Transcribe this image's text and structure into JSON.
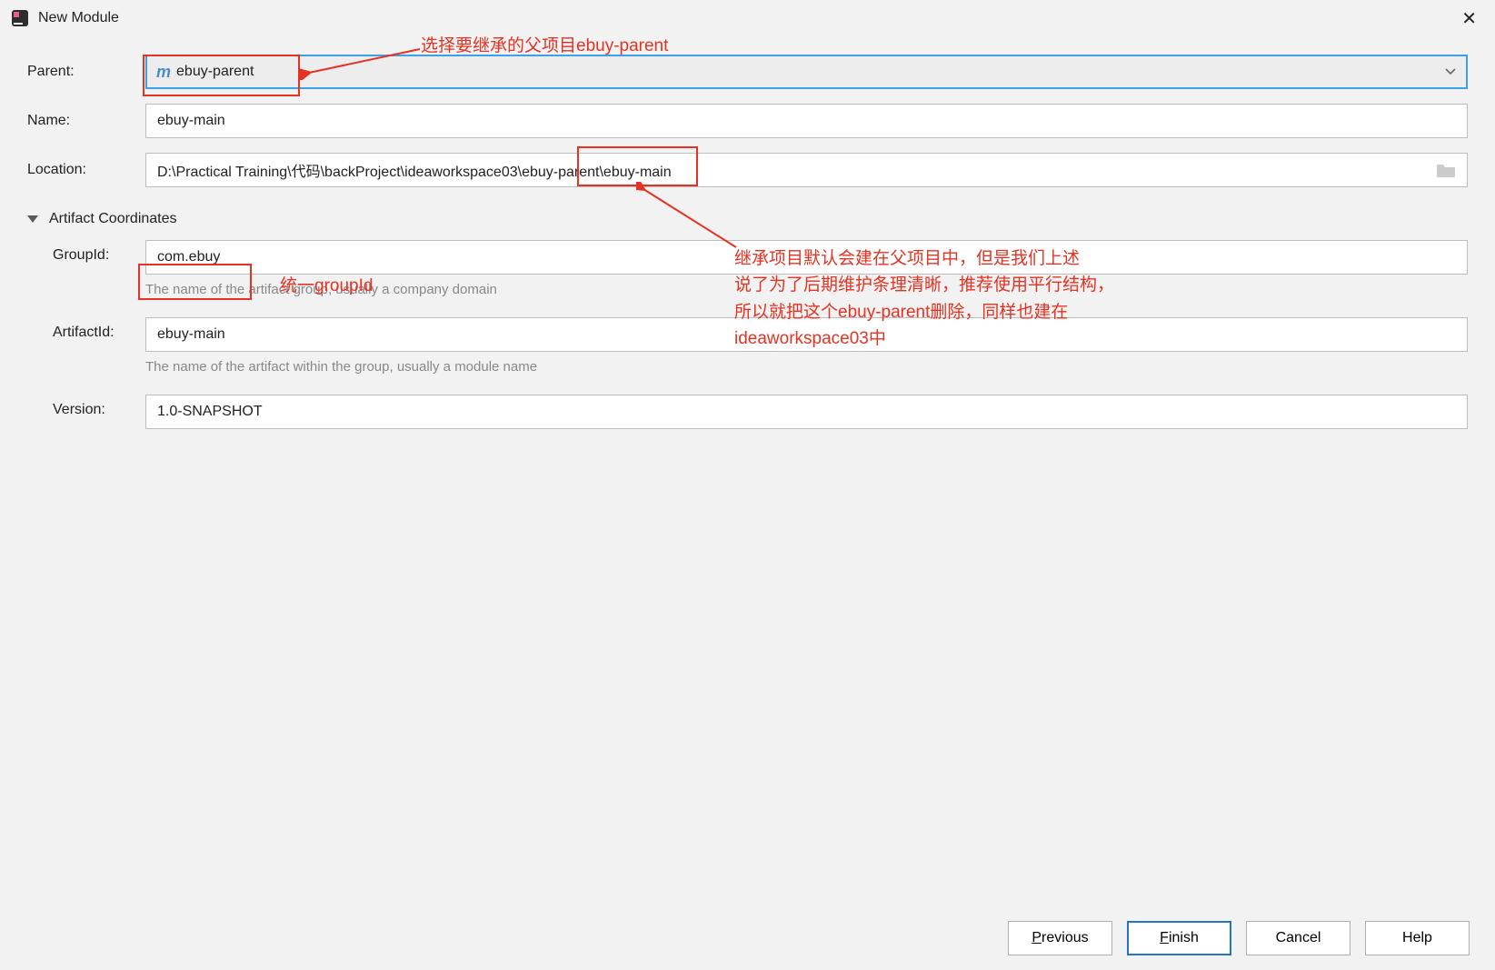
{
  "titlebar": {
    "title": "New Module"
  },
  "fields": {
    "parent_label": "Parent:",
    "parent_value": "ebuy-parent",
    "name_label": "Name:",
    "name_value": "ebuy-main",
    "location_label": "Location:",
    "location_prefix": "D:\\Practical Training\\代码\\backProject\\ideaworkspace03",
    "location_mid": "\\ebuy-parent",
    "location_suffix": "\\ebuy-main"
  },
  "section": {
    "title": "Artifact Coordinates"
  },
  "artifact": {
    "groupid_label": "GroupId:",
    "groupid_value": "com.ebuy",
    "groupid_hint": "The name of the artifact group, usually a company domain",
    "artifactid_label": "ArtifactId:",
    "artifactid_value": "ebuy-main",
    "artifactid_hint": "The name of the artifact within the group, usually a module name",
    "version_label": "Version:",
    "version_value": "1.0-SNAPSHOT"
  },
  "buttons": {
    "previous_p": "P",
    "previous_rest": "revious",
    "finish_f": "F",
    "finish_rest": "inish",
    "cancel": "Cancel",
    "help": "Help"
  },
  "annotations": {
    "annot1": "选择要继承的父项目ebuy-parent",
    "annot2": "统一groupId",
    "annot3_l1": "继承项目默认会建在父项目中，但是我们上述",
    "annot3_l2": "说了为了后期维护条理清晰，推荐使用平行结构，",
    "annot3_l3": "所以就把这个ebuy-parent删除，同样也建在",
    "annot3_l4": "ideaworkspace03中"
  }
}
